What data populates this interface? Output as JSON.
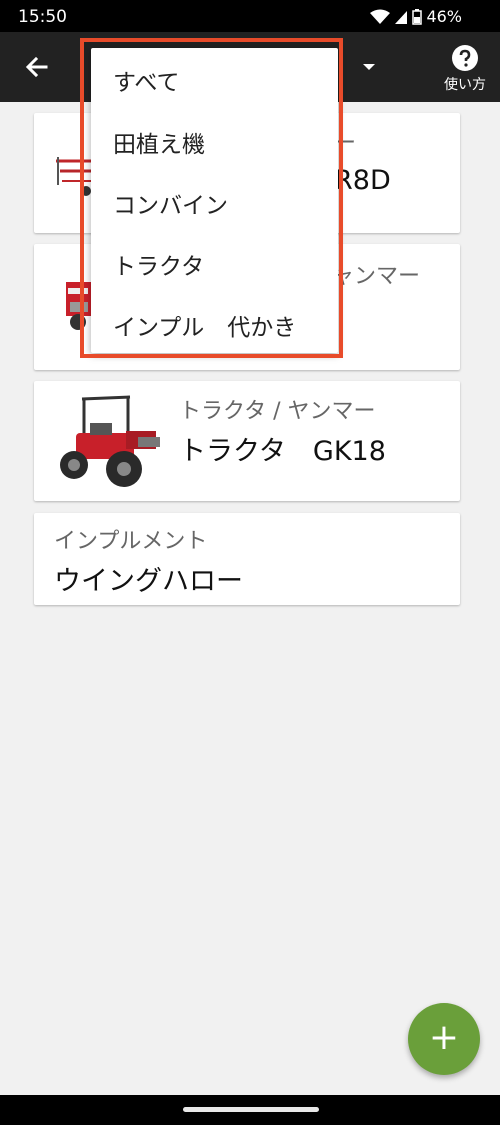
{
  "status": {
    "time": "15:50",
    "battery": "46%"
  },
  "toolbar": {
    "help_label": "使い方"
  },
  "machines": [
    {
      "meta_visible": "ー",
      "title_visible": "R8D"
    },
    {
      "meta_visible": "ャンマー",
      "title_visible": ""
    },
    {
      "meta": "トラクタ / ヤンマー",
      "title": "トラクタ　GK18"
    },
    {
      "meta": "インプルメント",
      "title": "ウイングハロー"
    }
  ],
  "filter_menu": {
    "items": [
      "すべて",
      "田植え機",
      "コンバイン",
      "トラクタ",
      "インプル　代かき"
    ]
  },
  "colors": {
    "accent": "#6a9f3a",
    "highlight": "#e84b2a",
    "appbar": "#222222"
  }
}
